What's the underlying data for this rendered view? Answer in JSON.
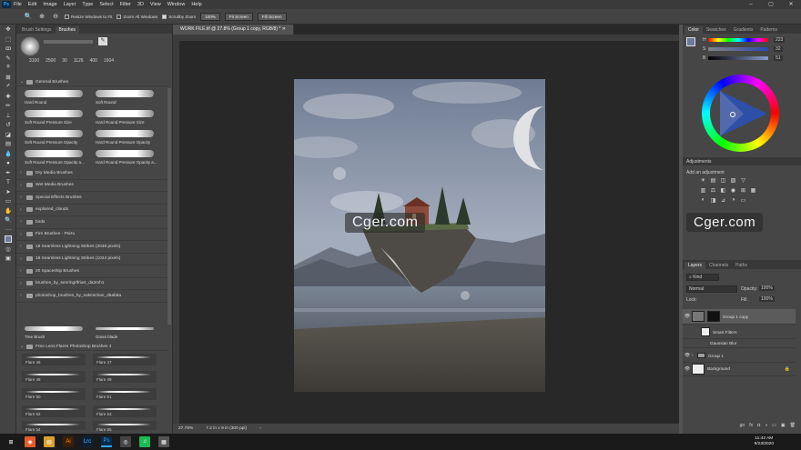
{
  "app": {
    "logo": "Ps",
    "menu": [
      "File",
      "Edit",
      "Image",
      "Layer",
      "Type",
      "Select",
      "Filter",
      "3D",
      "View",
      "Window",
      "Help"
    ],
    "window_controls": [
      "–",
      "▢",
      "✕"
    ]
  },
  "options_bar": {
    "resize_windows": "Resize Windows to Fit",
    "zoom_all": "Zoom All Windows",
    "scrubby_zoom": "Scrubby Zoom",
    "zoom_value": "100%",
    "fit_screen": "Fit Screen",
    "fill_screen": "Fill Screen"
  },
  "brush_panel": {
    "tabs": [
      "Brush Settings",
      "Brushes"
    ],
    "sizes": [
      "3100",
      "2500",
      "30",
      "1126",
      "400",
      "1604"
    ],
    "general_group": "General Brushes",
    "brushes": [
      "Hard Round",
      "Soft Round",
      "Soft Round Pressure Size",
      "Hard Round Pressure Size",
      "Soft Round Pressure Opacity",
      "Hard Round Pressure Opacity",
      "Soft Round Pressure Opacity a...",
      "Hard Round Pressure Opacity a..."
    ],
    "groups": [
      "Dry Media Brushes",
      "Wet Media Brushes",
      "Special Effects Brushes",
      "exploired_clouds",
      "birds",
      "Fire Brushes - Psizu",
      "18 Seamless Lightning Strikes (2048 pixels)",
      "18 Seamless Lightning Strikes (1024 pixels)",
      "20 Spaceship Brushes",
      "brushes_by_senringrlfriart_da2mh1",
      "photoshop_brushes_by_sakmichan_d5ab8a"
    ],
    "tree_brushes": [
      "Tree Brush",
      "Grass blade"
    ],
    "flare_group": "Free Lens Flares Photoshop Brushes 4",
    "flares": [
      "Flare 46",
      "Flare 47",
      "Flare 48",
      "Flare 49",
      "Flare 50",
      "Flare 51",
      "Flare 52",
      "Flare 53",
      "Flare 54",
      "Flare 55"
    ]
  },
  "document": {
    "tab_title": "WORK FILE.tif @ 27.8% (Group 1 copy, RGB/8) *",
    "zoom": "27.78%",
    "size": "7.2 in x 9 in (300 ppi)"
  },
  "color_panel": {
    "tabs": [
      "Color",
      "Swatches",
      "Gradients",
      "Patterns"
    ],
    "h_label": "H",
    "h_value": "223",
    "s_label": "S",
    "s_value": "32",
    "b_label": "B",
    "b_value": "51"
  },
  "adjustments": {
    "title": "Adjustments",
    "add_label": "Add an adjustment",
    "row1_icons": [
      "☀",
      "▤",
      "◫",
      "▨",
      "▽"
    ],
    "row2_icons": [
      "▥",
      "⚖",
      "◧",
      "◉",
      "⊞",
      "▦"
    ],
    "row3_icons": [
      "◐",
      "◨",
      "⊿",
      "◑",
      "▭"
    ]
  },
  "layers_panel": {
    "tabs": [
      "Layers",
      "Channels",
      "Paths"
    ],
    "kind": "Kind",
    "blend_mode": "Normal",
    "opacity_label": "Opacity:",
    "opacity": "100%",
    "lock_label": "Lock:",
    "fill_label": "Fill:",
    "fill": "100%",
    "layers": [
      "Group 1 copy",
      "Smart Filters",
      "Gaussian Blur",
      "Group 1",
      "Background"
    ],
    "footer_icons": [
      "go",
      "fx",
      "◘",
      "◑",
      "▭",
      "▣",
      "🗑"
    ]
  },
  "watermark": "Cger.com",
  "taskbar": {
    "time": "11:42 AM",
    "date": "9/23/2020",
    "apps": [
      "⊞",
      "◉",
      "▤",
      "Ai",
      "Lrc",
      "Ps",
      "◎",
      "♫",
      "▦"
    ]
  },
  "colors": {
    "accent": "#31a8ff",
    "panel": "#464646",
    "dark": "#282828"
  }
}
